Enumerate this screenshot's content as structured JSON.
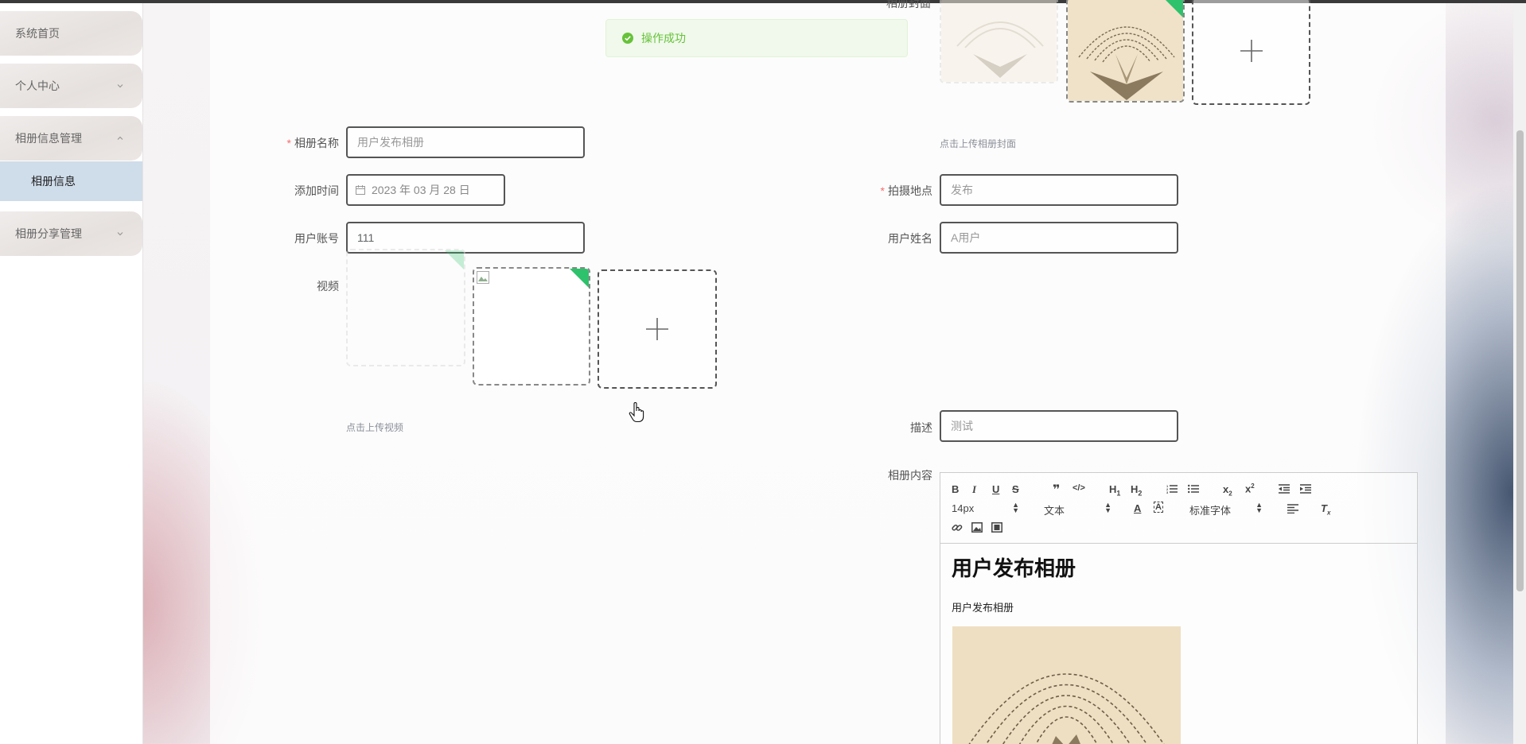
{
  "sidebar": {
    "items": [
      {
        "label": "系统首页"
      },
      {
        "label": "个人中心"
      },
      {
        "label": "相册信息管理"
      },
      {
        "label": "相册分享管理"
      }
    ],
    "sub_item": "相册信息"
  },
  "toast": {
    "message": "操作成功",
    "color": "#67c23a"
  },
  "form": {
    "cover_label": "相册封面",
    "cover_hint": "点击上传相册封面",
    "name_label": "相册名称",
    "name_placeholder": "用户发布相册",
    "time_label": "添加时间",
    "time_value": "2023 年 03 月 28 日",
    "location_label": "拍摄地点",
    "location_placeholder": "发布",
    "account_label": "用户账号",
    "account_value": "111",
    "username_label": "用户姓名",
    "username_placeholder": "A用户",
    "video_label": "视频",
    "video_hint": "点击上传视频",
    "desc_label": "描述",
    "desc_placeholder": "测试",
    "content_label": "相册内容"
  },
  "editor": {
    "font_size": "14px",
    "block_type": "文本",
    "font_family": "标准字体",
    "heading": "用户发布相册",
    "paragraph": "用户发布相册"
  },
  "icons": [
    "check-circle-icon",
    "chevron-down-icon",
    "chevron-up-icon",
    "calendar-icon",
    "plus-icon",
    "hand-cursor-icon",
    "bold-icon",
    "italic-icon",
    "underline-icon",
    "strike-icon",
    "quote-icon",
    "code-icon",
    "h1-icon",
    "h2-icon",
    "ordered-list-icon",
    "bullet-list-icon",
    "subscript-icon",
    "superscript-icon",
    "outdent-icon",
    "indent-icon",
    "text-color-icon",
    "background-color-icon",
    "align-icon",
    "clear-format-icon",
    "link-icon",
    "image-icon",
    "video-icon"
  ]
}
